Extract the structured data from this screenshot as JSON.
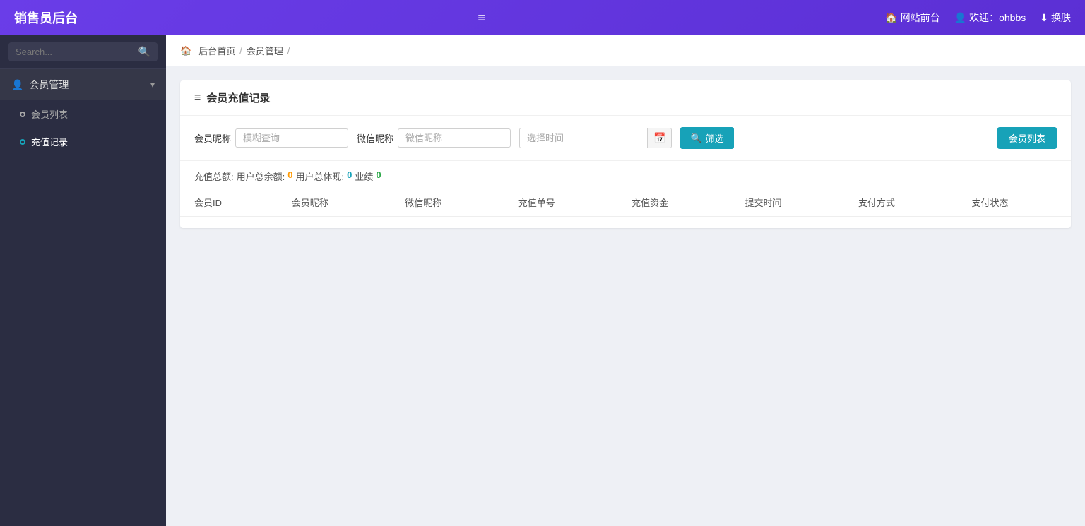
{
  "app": {
    "title": "销售员后台"
  },
  "topbar": {
    "hamburger": "≡",
    "website_link": "网站前台",
    "welcome": "欢迎：ohbbs",
    "switch": "换肤"
  },
  "sidebar": {
    "search_placeholder": "Search...",
    "menu_group": {
      "label": "会员管理",
      "icon": "👤",
      "arrow": "▾"
    },
    "items": [
      {
        "label": "会员列表",
        "active": false
      },
      {
        "label": "充值记录",
        "active": true
      }
    ]
  },
  "breadcrumb": {
    "home": "后台首页",
    "current": "会员管理"
  },
  "page": {
    "card_title": "会员充值记录",
    "filter": {
      "member_name_label": "会员昵称",
      "member_name_placeholder": "模糊查询",
      "wechat_label": "微信昵称",
      "wechat_placeholder": "微信昵称",
      "date_placeholder": "选择时间",
      "filter_btn": "筛选",
      "member_list_btn": "会员列表"
    },
    "stats": {
      "label": "充值总额:",
      "user_balance_label": "用户总余额:",
      "user_balance_val": "0",
      "user_cash_label": "用户总体现:",
      "user_cash_val": "0",
      "performance_label": "业绩",
      "performance_val": "0"
    },
    "table": {
      "columns": [
        "会员ID",
        "会员昵称",
        "微信昵称",
        "充值单号",
        "充值资金",
        "提交时间",
        "支付方式",
        "支付状态"
      ]
    }
  }
}
